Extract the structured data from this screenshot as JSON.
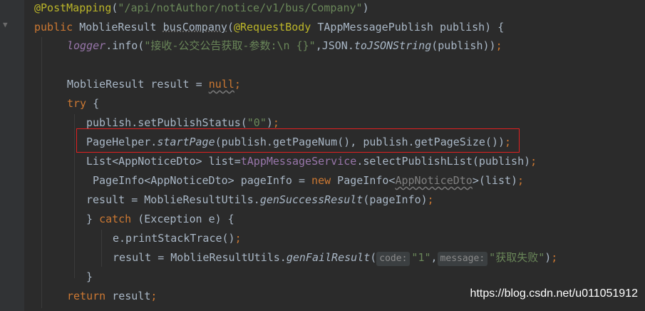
{
  "code": {
    "l1": {
      "ann": "@PostMapping",
      "p1": "(",
      "str": "\"/api/notAuthor/notice/v1/bus/Company\"",
      "p2": ")"
    },
    "l2": {
      "kw": "public ",
      "type": "MoblieResult ",
      "method": "busCompany",
      "p1": "(",
      "ann": "@RequestBody",
      "rest": " TAppMessagePublish publish) {"
    },
    "l3": {
      "field": "logger",
      "p1": ".info(",
      "str": "\"接收-公交公告获取-参数:\\n {}\"",
      "p2": ",JSON.",
      "fn": "toJSONString",
      "p3": "(publish))",
      "semi": ";"
    },
    "l5": {
      "p1": "MoblieResult result = ",
      "kw": "null",
      "semi": ";"
    },
    "l6": {
      "kw": "try ",
      "p1": "{"
    },
    "l7": {
      "p1": "publish.setPublishStatus(",
      "str": "\"0\"",
      "p2": ")",
      "semi": ";"
    },
    "l8": {
      "p1": "PageHelper.",
      "fn": "startPage",
      "p2": "(publish.getPageNum(), publish.getPageSize())",
      "semi": ";"
    },
    "l9": {
      "p1": "List<AppNoticeDto> list=",
      "field": "tAppMessageService",
      "p2": ".selectPublishList(publish)",
      "semi": ";"
    },
    "l10": {
      "p1": "PageInfo<AppNoticeDto> pageInfo = ",
      "kw": "new ",
      "p2": "PageInfo<",
      "sq": "AppNoticeDto",
      "p3": ">(list)",
      "semi": ";"
    },
    "l11": {
      "p1": "result = MoblieResultUtils.",
      "fn": "genSuccessResult",
      "p2": "(pageInfo)",
      "semi": ";"
    },
    "l12": {
      "p1": "} ",
      "kw": "catch ",
      "p2": "(Exception e) {"
    },
    "l13": {
      "p1": "e.printStackTrace()",
      "semi": ";"
    },
    "l14": {
      "p1": "result = MoblieResultUtils.",
      "fn": "genFailResult",
      "p2": "(",
      "hint1": "code:",
      "str1": "\"1\"",
      "p3": ",",
      "hint2": "message:",
      "str2": "\"获取失败\"",
      "p4": ")",
      "semi": ";"
    },
    "l15": {
      "p1": "}"
    },
    "l16": {
      "kw": "return ",
      "p1": "result",
      "semi": ";"
    }
  },
  "watermark": "https://blog.csdn.net/u011051912",
  "colors": {
    "background": "#2b2b2b",
    "keyword": "#cc7832",
    "string": "#6a8759",
    "annotation": "#bbb529",
    "highlight_box": "#e02020"
  }
}
